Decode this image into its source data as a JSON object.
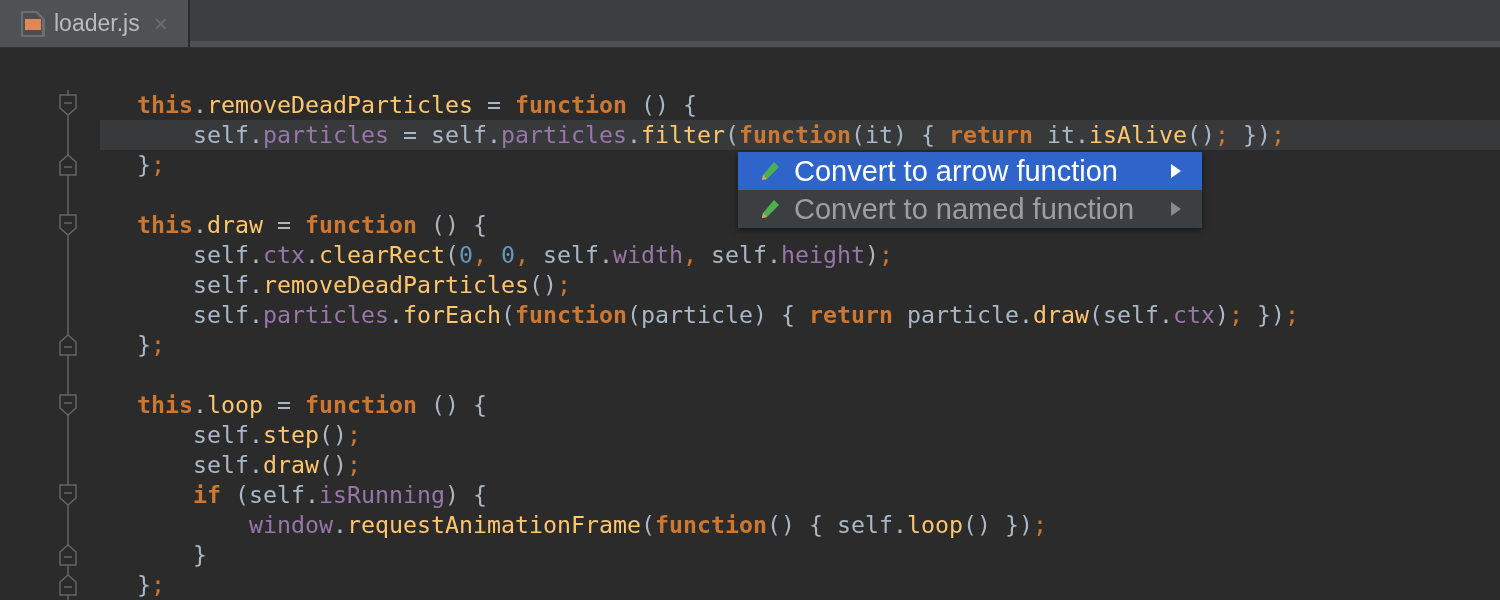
{
  "tabs": [
    {
      "label": "loader.js",
      "close": "×",
      "selected": true
    }
  ],
  "lines": [
    {
      "kind": "code",
      "fold_start": true,
      "fold_end": false,
      "current": false,
      "tokens": [
        {
          "t": "this",
          "kind": "keyword"
        },
        {
          "t": ".",
          "kind": "plain"
        },
        {
          "t": "removeDeadParticles",
          "kind": "method"
        },
        {
          "t": " = ",
          "kind": "plain"
        },
        {
          "t": "function",
          "kind": "keyword"
        },
        {
          "t": " () {",
          "kind": "plain"
        }
      ]
    },
    {
      "kind": "code",
      "fold_start": false,
      "fold_end": false,
      "current": true,
      "tokens": [
        {
          "t": "    self.",
          "kind": "plain"
        },
        {
          "t": "particles",
          "kind": "property"
        },
        {
          "t": " = self.",
          "kind": "plain"
        },
        {
          "t": "particles",
          "kind": "property"
        },
        {
          "t": ".",
          "kind": "plain"
        },
        {
          "t": "filter",
          "kind": "method"
        },
        {
          "t": "(",
          "kind": "plain"
        },
        {
          "t": "function",
          "kind": "keyword"
        },
        {
          "t": "(it) { ",
          "kind": "plain"
        },
        {
          "t": "return",
          "kind": "keyword"
        },
        {
          "t": " it.",
          "kind": "plain"
        },
        {
          "t": "isAlive",
          "kind": "method"
        },
        {
          "t": "()",
          "kind": "plain"
        },
        {
          "t": ";",
          "kind": "punct"
        },
        {
          "t": " })",
          "kind": "plain"
        },
        {
          "t": ";",
          "kind": "punct"
        }
      ]
    },
    {
      "kind": "code",
      "fold_start": false,
      "fold_end": true,
      "current": false,
      "tokens": [
        {
          "t": "}",
          "kind": "plain"
        },
        {
          "t": ";",
          "kind": "punct"
        }
      ]
    },
    {
      "kind": "blank",
      "fold_start": false,
      "fold_end": false,
      "current": false
    },
    {
      "kind": "code",
      "fold_start": true,
      "fold_end": false,
      "current": false,
      "tokens": [
        {
          "t": "this",
          "kind": "keyword"
        },
        {
          "t": ".",
          "kind": "plain"
        },
        {
          "t": "draw",
          "kind": "method"
        },
        {
          "t": " = ",
          "kind": "plain"
        },
        {
          "t": "function",
          "kind": "keyword"
        },
        {
          "t": " () {",
          "kind": "plain"
        }
      ]
    },
    {
      "kind": "code",
      "fold_start": false,
      "fold_end": false,
      "current": false,
      "tokens": [
        {
          "t": "    self.",
          "kind": "plain"
        },
        {
          "t": "ctx",
          "kind": "property"
        },
        {
          "t": ".",
          "kind": "plain"
        },
        {
          "t": "clearRect",
          "kind": "method"
        },
        {
          "t": "(",
          "kind": "plain"
        },
        {
          "t": "0",
          "kind": "number"
        },
        {
          "t": ",",
          "kind": "punct"
        },
        {
          "t": " 0",
          "kind": "number"
        },
        {
          "t": ",",
          "kind": "punct"
        },
        {
          "t": " self.",
          "kind": "plain"
        },
        {
          "t": "width",
          "kind": "property"
        },
        {
          "t": ",",
          "kind": "punct"
        },
        {
          "t": " self.",
          "kind": "plain"
        },
        {
          "t": "height",
          "kind": "property"
        },
        {
          "t": ")",
          "kind": "plain"
        },
        {
          "t": ";",
          "kind": "punct"
        }
      ]
    },
    {
      "kind": "code",
      "fold_start": false,
      "fold_end": false,
      "current": false,
      "tokens": [
        {
          "t": "    self.",
          "kind": "plain"
        },
        {
          "t": "removeDeadParticles",
          "kind": "method"
        },
        {
          "t": "()",
          "kind": "plain"
        },
        {
          "t": ";",
          "kind": "punct"
        }
      ]
    },
    {
      "kind": "code",
      "fold_start": false,
      "fold_end": false,
      "current": false,
      "tokens": [
        {
          "t": "    self.",
          "kind": "plain"
        },
        {
          "t": "particles",
          "kind": "property"
        },
        {
          "t": ".",
          "kind": "plain"
        },
        {
          "t": "forEach",
          "kind": "method"
        },
        {
          "t": "(",
          "kind": "plain"
        },
        {
          "t": "function",
          "kind": "keyword"
        },
        {
          "t": "(particle) { ",
          "kind": "plain"
        },
        {
          "t": "return",
          "kind": "keyword"
        },
        {
          "t": " particle.",
          "kind": "plain"
        },
        {
          "t": "draw",
          "kind": "method"
        },
        {
          "t": "(self.",
          "kind": "plain"
        },
        {
          "t": "ctx",
          "kind": "property"
        },
        {
          "t": ")",
          "kind": "plain"
        },
        {
          "t": ";",
          "kind": "punct"
        },
        {
          "t": " })",
          "kind": "plain"
        },
        {
          "t": ";",
          "kind": "punct"
        }
      ]
    },
    {
      "kind": "code",
      "fold_start": false,
      "fold_end": true,
      "current": false,
      "tokens": [
        {
          "t": "}",
          "kind": "plain"
        },
        {
          "t": ";",
          "kind": "punct"
        }
      ]
    },
    {
      "kind": "blank",
      "fold_start": false,
      "fold_end": false,
      "current": false
    },
    {
      "kind": "code",
      "fold_start": true,
      "fold_end": false,
      "current": false,
      "tokens": [
        {
          "t": "this",
          "kind": "keyword"
        },
        {
          "t": ".",
          "kind": "plain"
        },
        {
          "t": "loop",
          "kind": "method"
        },
        {
          "t": " = ",
          "kind": "plain"
        },
        {
          "t": "function",
          "kind": "keyword"
        },
        {
          "t": " () {",
          "kind": "plain"
        }
      ]
    },
    {
      "kind": "code",
      "fold_start": false,
      "fold_end": false,
      "current": false,
      "tokens": [
        {
          "t": "    self.",
          "kind": "plain"
        },
        {
          "t": "step",
          "kind": "method"
        },
        {
          "t": "()",
          "kind": "plain"
        },
        {
          "t": ";",
          "kind": "punct"
        }
      ]
    },
    {
      "kind": "code",
      "fold_start": false,
      "fold_end": false,
      "current": false,
      "tokens": [
        {
          "t": "    self.",
          "kind": "plain"
        },
        {
          "t": "draw",
          "kind": "method"
        },
        {
          "t": "()",
          "kind": "plain"
        },
        {
          "t": ";",
          "kind": "punct"
        }
      ]
    },
    {
      "kind": "code",
      "fold_start": true,
      "fold_end": false,
      "current": false,
      "tokens": [
        {
          "t": "    if",
          "kind": "keyword"
        },
        {
          "t": " (self.",
          "kind": "plain"
        },
        {
          "t": "isRunning",
          "kind": "property"
        },
        {
          "t": ") {",
          "kind": "plain"
        }
      ]
    },
    {
      "kind": "code",
      "fold_start": false,
      "fold_end": false,
      "current": false,
      "tokens": [
        {
          "t": "        window",
          "kind": "property"
        },
        {
          "t": ".",
          "kind": "plain"
        },
        {
          "t": "requestAnimationFrame",
          "kind": "method"
        },
        {
          "t": "(",
          "kind": "plain"
        },
        {
          "t": "function",
          "kind": "keyword"
        },
        {
          "t": "() { self.",
          "kind": "plain"
        },
        {
          "t": "loop",
          "kind": "method"
        },
        {
          "t": "() })",
          "kind": "plain"
        },
        {
          "t": ";",
          "kind": "punct"
        }
      ]
    },
    {
      "kind": "code",
      "fold_start": false,
      "fold_end": true,
      "current": false,
      "tokens": [
        {
          "t": "    }",
          "kind": "plain"
        }
      ]
    },
    {
      "kind": "code",
      "fold_start": false,
      "fold_end": true,
      "current": false,
      "tokens": [
        {
          "t": "}",
          "kind": "plain"
        },
        {
          "t": ";",
          "kind": "punct"
        }
      ]
    }
  ],
  "popup": {
    "items": [
      {
        "label": "Convert to arrow function",
        "selected": true
      },
      {
        "label": "Convert to named function",
        "selected": false
      }
    ]
  }
}
